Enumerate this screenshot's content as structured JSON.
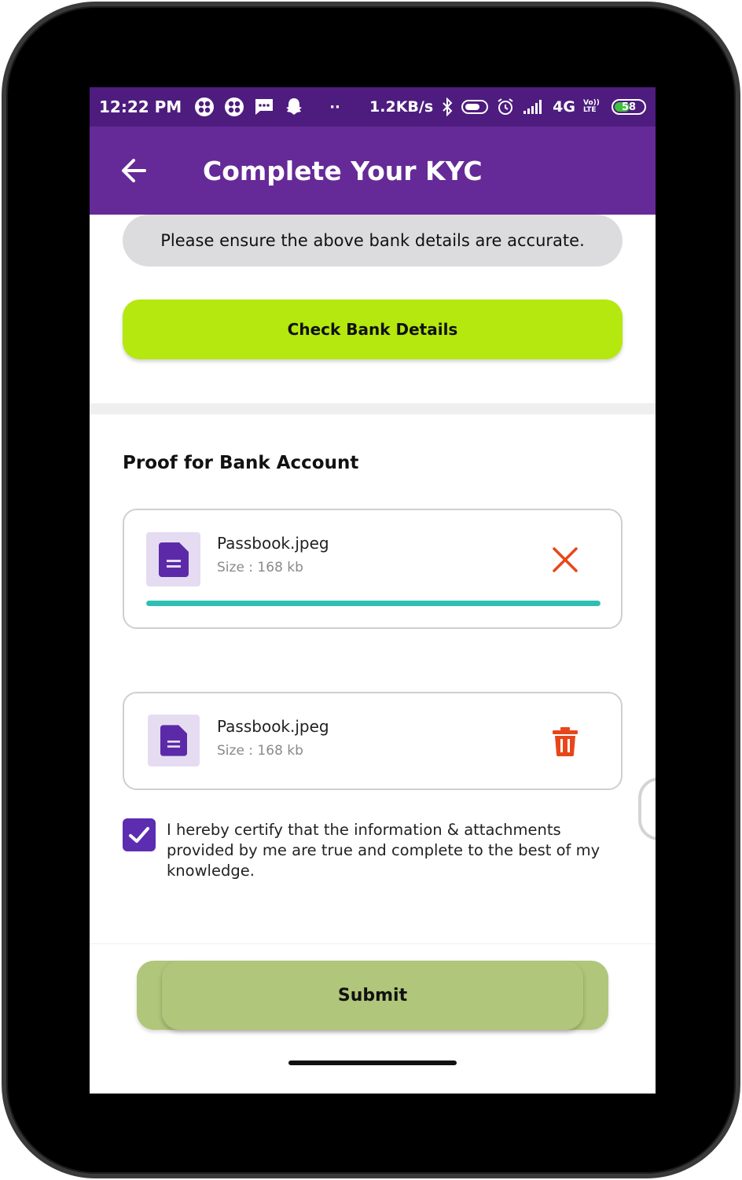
{
  "status_bar": {
    "time": "12:22 PM",
    "net_speed": "1.2KB/s",
    "network": "4G",
    "volte": "Vo)) LTE",
    "battery": "58",
    "battery_level": 0.58
  },
  "app_bar": {
    "title": "Complete Your KYC",
    "back_icon": "arrow-left-icon"
  },
  "notice": "Please ensure the above bank details are accurate.",
  "check_button": "Check Bank Details",
  "section_title": "Proof for Bank Account",
  "files": [
    {
      "name": "Passbook.jpeg",
      "size": "Size : 168 kb",
      "action_icon": "close-icon",
      "upload_progress": 1.0
    },
    {
      "name": "Passbook.jpeg",
      "size": "Size : 168 kb",
      "action_icon": "trash-icon"
    }
  ],
  "certify": {
    "checked": true,
    "text": "I hereby certify that the information & attachments provided by me are true and complete to the best of my knowledge."
  },
  "submit_button": "Submit",
  "colors": {
    "status_bar": "#4e1c7f",
    "app_bar": "#652a97",
    "check_button": "#b4e80e",
    "submit_button": "#b0c67a",
    "progress": "#2fbfb2",
    "delete": "#e8461a",
    "checkbox": "#5c2db0"
  }
}
